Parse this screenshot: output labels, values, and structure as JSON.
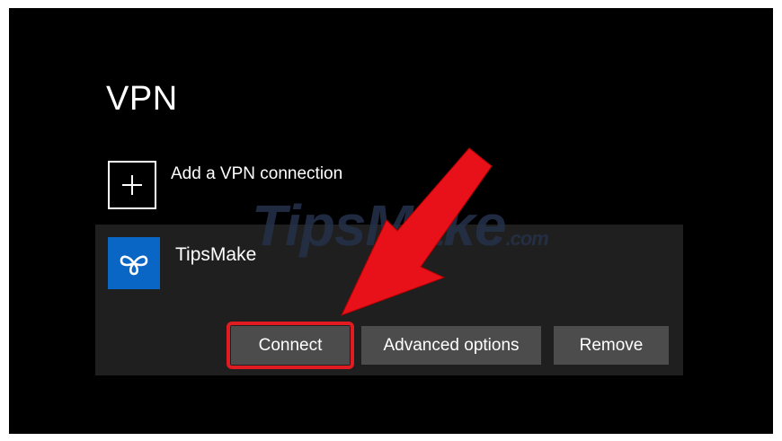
{
  "page": {
    "title": "VPN"
  },
  "add_connection": {
    "label": "Add a VPN connection",
    "icon": "plus-icon"
  },
  "connection": {
    "name": "TipsMake",
    "icon": "vpn-network-icon",
    "icon_color": "#0a66c4",
    "buttons": {
      "connect": "Connect",
      "advanced": "Advanced options",
      "remove": "Remove"
    }
  },
  "watermark": {
    "text": "TipsMake",
    "suffix": ".com"
  },
  "annotation": {
    "highlight_color": "#e11b22",
    "arrow": "red-arrow-icon"
  }
}
